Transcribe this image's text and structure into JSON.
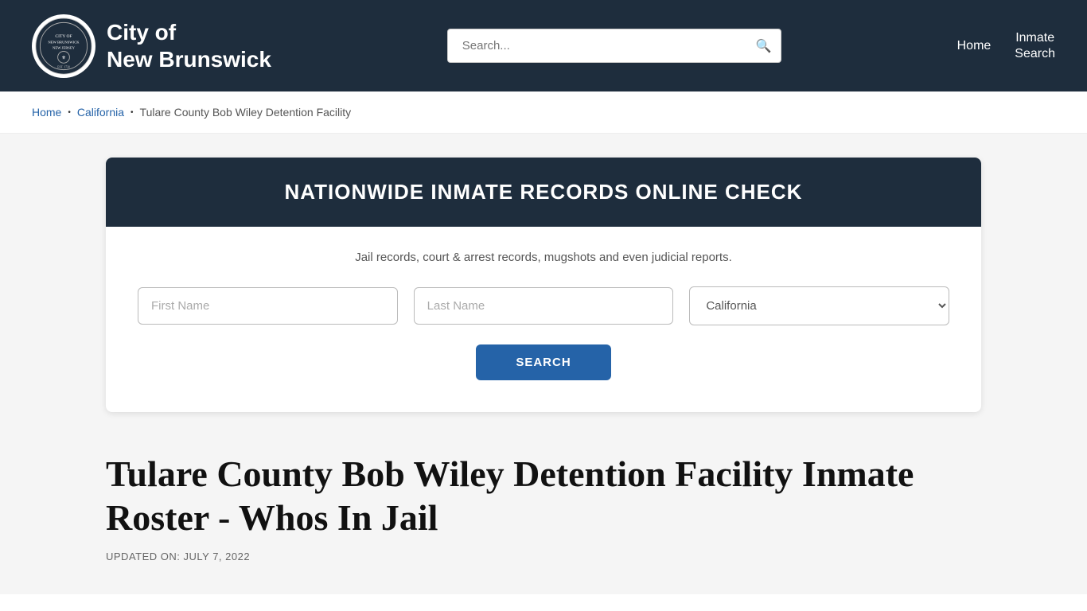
{
  "header": {
    "logo_line1": "City of",
    "logo_line2": "New Brunswick",
    "search_placeholder": "Search...",
    "nav_home": "Home",
    "nav_inmate_search_line1": "Inmate",
    "nav_inmate_search_line2": "Search"
  },
  "breadcrumb": {
    "home": "Home",
    "california": "California",
    "current": "Tulare County Bob Wiley Detention Facility"
  },
  "records_box": {
    "title": "NATIONWIDE INMATE RECORDS ONLINE CHECK",
    "description": "Jail records, court & arrest records, mugshots and even judicial reports.",
    "first_name_placeholder": "First Name",
    "last_name_placeholder": "Last Name",
    "state_value": "California",
    "search_button": "SEARCH"
  },
  "page": {
    "title": "Tulare County Bob Wiley Detention Facility Inmate Roster - Whos In Jail",
    "updated_label": "UPDATED ON: JULY 7, 2022"
  }
}
